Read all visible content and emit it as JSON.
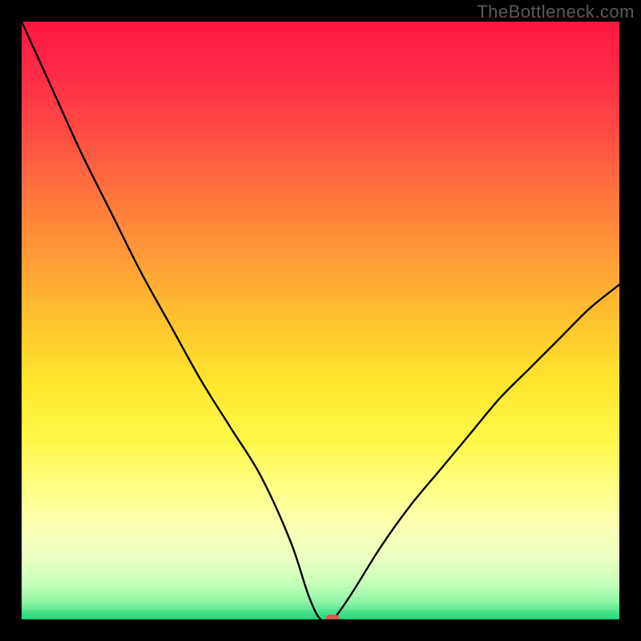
{
  "watermark": "TheBottleneck.com",
  "chart_data": {
    "type": "line",
    "title": "",
    "xlabel": "",
    "ylabel": "",
    "xlim": [
      0,
      100
    ],
    "ylim": [
      0,
      100
    ],
    "grid": false,
    "legend": false,
    "series": [
      {
        "name": "bottleneck-curve",
        "x": [
          0,
          5,
          10,
          15,
          20,
          25,
          30,
          35,
          40,
          45,
          48,
          50,
          52,
          55,
          60,
          65,
          70,
          75,
          80,
          85,
          90,
          95,
          100
        ],
        "values": [
          100,
          89,
          78,
          68,
          58,
          49,
          40,
          32,
          24,
          13,
          4,
          0,
          0,
          4,
          12,
          19,
          25,
          31,
          37,
          42,
          47,
          52,
          56
        ]
      }
    ],
    "marker": {
      "x": 52,
      "y": 0,
      "color": "#d35a53"
    },
    "background_gradient": {
      "type": "vertical",
      "stops": [
        {
          "pos": 0.0,
          "color": "#ff1744"
        },
        {
          "pos": 0.1,
          "color": "#ff2f46"
        },
        {
          "pos": 0.2,
          "color": "#ff5243"
        },
        {
          "pos": 0.3,
          "color": "#ff7a3d"
        },
        {
          "pos": 0.4,
          "color": "#ff9e35"
        },
        {
          "pos": 0.5,
          "color": "#ffc42e"
        },
        {
          "pos": 0.6,
          "color": "#ffe52d"
        },
        {
          "pos": 0.7,
          "color": "#fff84a"
        },
        {
          "pos": 0.78,
          "color": "#feff87"
        },
        {
          "pos": 0.85,
          "color": "#fbffb8"
        },
        {
          "pos": 0.9,
          "color": "#e8ffc1"
        },
        {
          "pos": 0.94,
          "color": "#c3ffb8"
        },
        {
          "pos": 0.97,
          "color": "#8cf5a4"
        },
        {
          "pos": 0.985,
          "color": "#4de28f"
        },
        {
          "pos": 1.0,
          "color": "#16d67a"
        }
      ]
    }
  }
}
